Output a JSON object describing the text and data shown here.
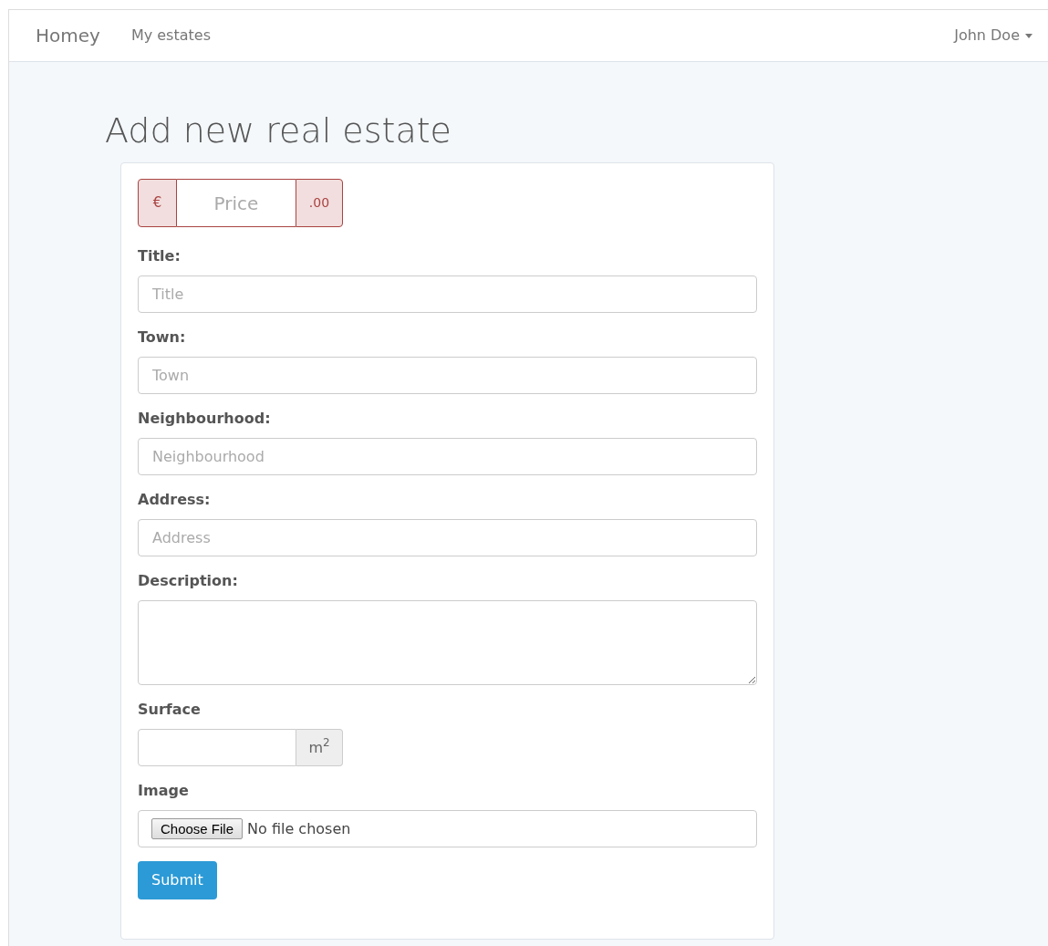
{
  "navbar": {
    "brand": "Homey",
    "links": [
      "My estates"
    ],
    "user": "John Doe"
  },
  "page_title": "Add new real estate",
  "price": {
    "prefix": "€",
    "placeholder": "Price",
    "suffix": ".00",
    "error": true
  },
  "fields": [
    {
      "kind": "text",
      "label": "Title:",
      "placeholder": "Title"
    },
    {
      "kind": "text",
      "label": "Town:",
      "placeholder": "Town"
    },
    {
      "kind": "text",
      "label": "Neighbourhood:",
      "placeholder": "Neighbourhood"
    },
    {
      "kind": "text",
      "label": "Address:",
      "placeholder": "Address"
    },
    {
      "kind": "textarea",
      "label": "Description:"
    },
    {
      "kind": "addon",
      "label": "Surface",
      "suffix": "m$^{2}$"
    },
    {
      "kind": "file",
      "label": "Image",
      "button": "Choose File",
      "status": "No file chosen"
    }
  ],
  "submit": "Submit"
}
